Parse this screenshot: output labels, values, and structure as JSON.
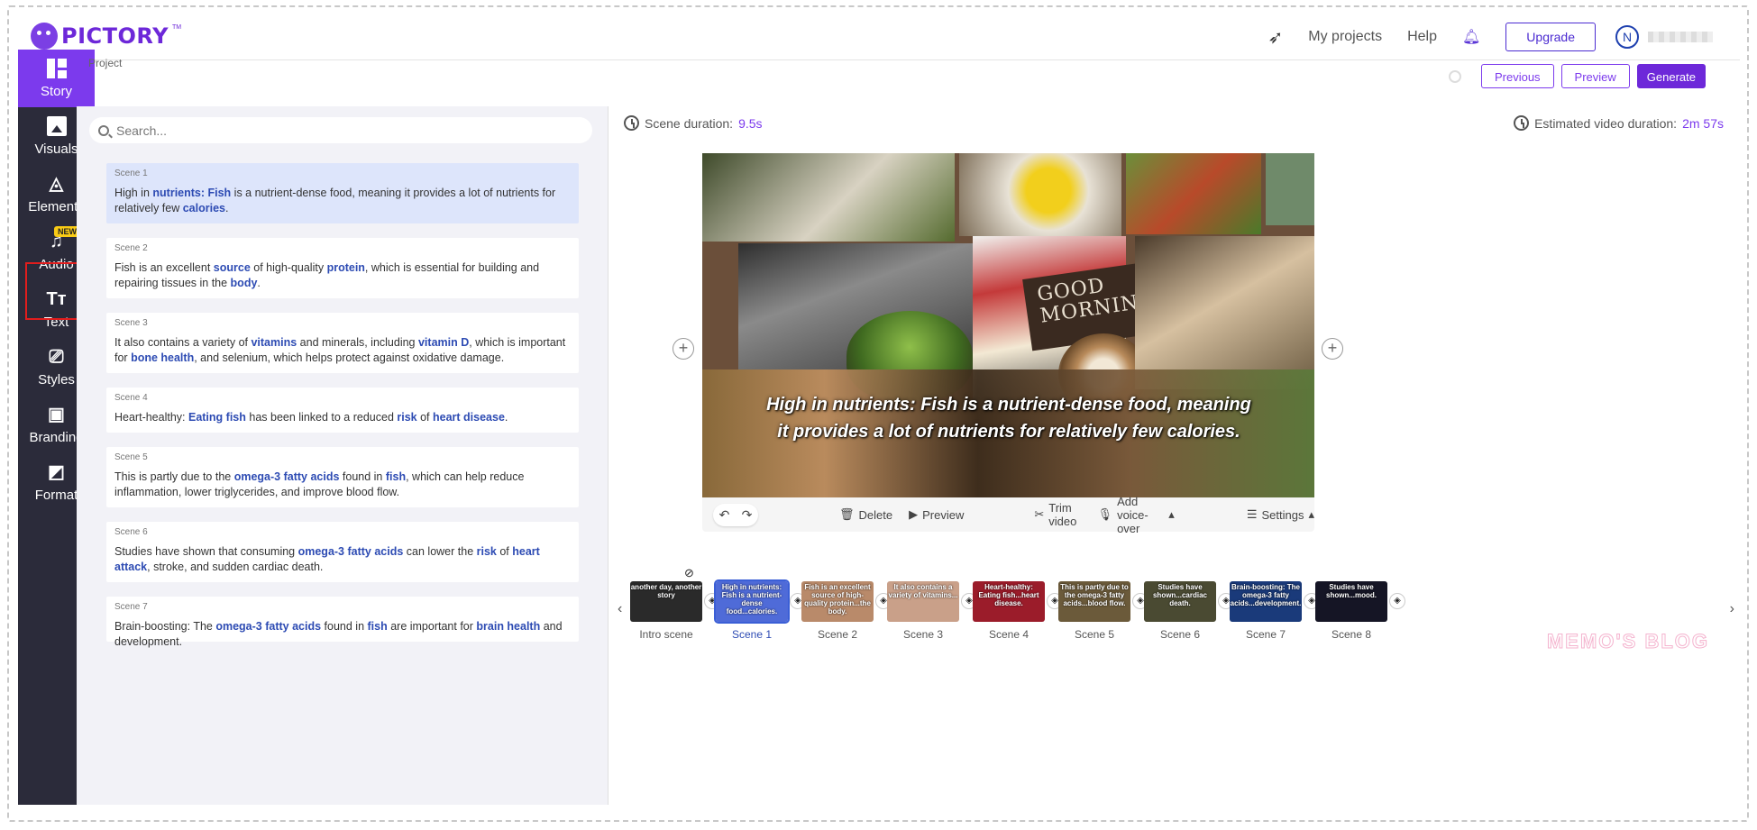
{
  "brand": {
    "name": "PICTORY",
    "tm": "TM"
  },
  "topnav": {
    "my_projects": "My projects",
    "help": "Help",
    "upgrade": "Upgrade",
    "avatar_initial": "N"
  },
  "sidebar": {
    "items": [
      {
        "label": "Story",
        "icon": "story-icon"
      },
      {
        "label": "Visuals",
        "icon": "image-icon"
      },
      {
        "label": "Elements",
        "icon": "shapes-icon"
      },
      {
        "label": "Audio",
        "icon": "music-note-icon",
        "badge": "NEW"
      },
      {
        "label": "Text",
        "icon": "text-icon"
      },
      {
        "label": "Styles",
        "icon": "styles-icon"
      },
      {
        "label": "Branding",
        "icon": "briefcase-icon"
      },
      {
        "label": "Format",
        "icon": "format-icon"
      }
    ]
  },
  "project": {
    "label": "Project",
    "previous": "Previous",
    "preview": "Preview",
    "generate": "Generate"
  },
  "search": {
    "placeholder": "Search..."
  },
  "scenes": [
    {
      "label": "Scene 1"
    },
    {
      "label": "Scene 2"
    },
    {
      "label": "Scene 3"
    },
    {
      "label": "Scene 4"
    },
    {
      "label": "Scene 5"
    },
    {
      "label": "Scene 6"
    },
    {
      "label": "Scene 7"
    }
  ],
  "scene_text": {
    "s1": [
      "High in ",
      "nutrients: Fish",
      " is a nutrient-dense food, meaning it provides a lot of nutrients for relatively few ",
      "calories",
      "."
    ],
    "s2": [
      "Fish is an excellent ",
      "source",
      " of high-quality ",
      "protein",
      ", which is essential for building and repairing tissues in the ",
      "body",
      "."
    ],
    "s3": [
      "It also contains a variety of ",
      "vitamins",
      " and minerals, including ",
      "vitamin D",
      ", which is important for ",
      "bone health",
      ", and selenium, which helps protect against oxidative damage."
    ],
    "s4": [
      "Heart-healthy: ",
      "Eating fish",
      " has been linked to a reduced ",
      "risk",
      " of ",
      "heart disease",
      "."
    ],
    "s5": [
      "This is partly due to the ",
      "omega-3 fatty acids",
      " found in ",
      "fish",
      ", which can help reduce inflammation, lower triglycerides, and improve blood flow."
    ],
    "s6": [
      "Studies have shown that consuming ",
      "omega-3 fatty acids",
      " can lower the ",
      "risk",
      " of ",
      "heart attack",
      ", stroke, and sudden cardiac death."
    ],
    "s7": [
      "Brain-boosting: The ",
      "omega-3 fatty acids",
      " found in ",
      "fish",
      " are important for ",
      "brain health",
      " and development."
    ]
  },
  "durations": {
    "scene_label": "Scene duration:",
    "scene_value": "9.5s",
    "video_label": "Estimated video duration:",
    "video_value": "2m 57s"
  },
  "canvas": {
    "caption": "High in nutrients: Fish is a nutrient-dense food, meaning it provides a lot of nutrients for relatively few calories.",
    "sign_text": "GOOD MORNING"
  },
  "toolbar": {
    "delete": "Delete",
    "preview": "Preview",
    "trim": "Trim video",
    "voice": "Add voice-over",
    "settings": "Settings"
  },
  "filmstrip": [
    {
      "label": "Intro scene",
      "text": "another day, another story",
      "color": "#2a2a2a"
    },
    {
      "label": "Scene 1",
      "text": "High in nutrients: Fish is a nutrient-dense food...calories.",
      "color": "#4f6bd8"
    },
    {
      "label": "Scene 2",
      "text": "Fish is an excellent source of high-quality protein...the body.",
      "color": "#b98a6a"
    },
    {
      "label": "Scene 3",
      "text": "It also contains a variety of vitamins...",
      "color": "#c9a089"
    },
    {
      "label": "Scene 4",
      "text": "Heart-healthy: Eating fish...heart disease.",
      "color": "#9b1c2a"
    },
    {
      "label": "Scene 5",
      "text": "This is partly due to the omega-3 fatty acids...blood flow.",
      "color": "#6b5a3a"
    },
    {
      "label": "Scene 6",
      "text": "Studies have shown...cardiac death.",
      "color": "#4a4a32"
    },
    {
      "label": "Scene 7",
      "text": "Brain-boosting: The omega-3 fatty acids...development.",
      "color": "#1a3a7a"
    },
    {
      "label": "Scene 8",
      "text": "Studies have shown...mood.",
      "color": "#151525"
    }
  ],
  "colors": {
    "accent": "#7c3aed",
    "keyword": "#2d4bb3",
    "sidebar_bg": "#2b2b3a"
  }
}
